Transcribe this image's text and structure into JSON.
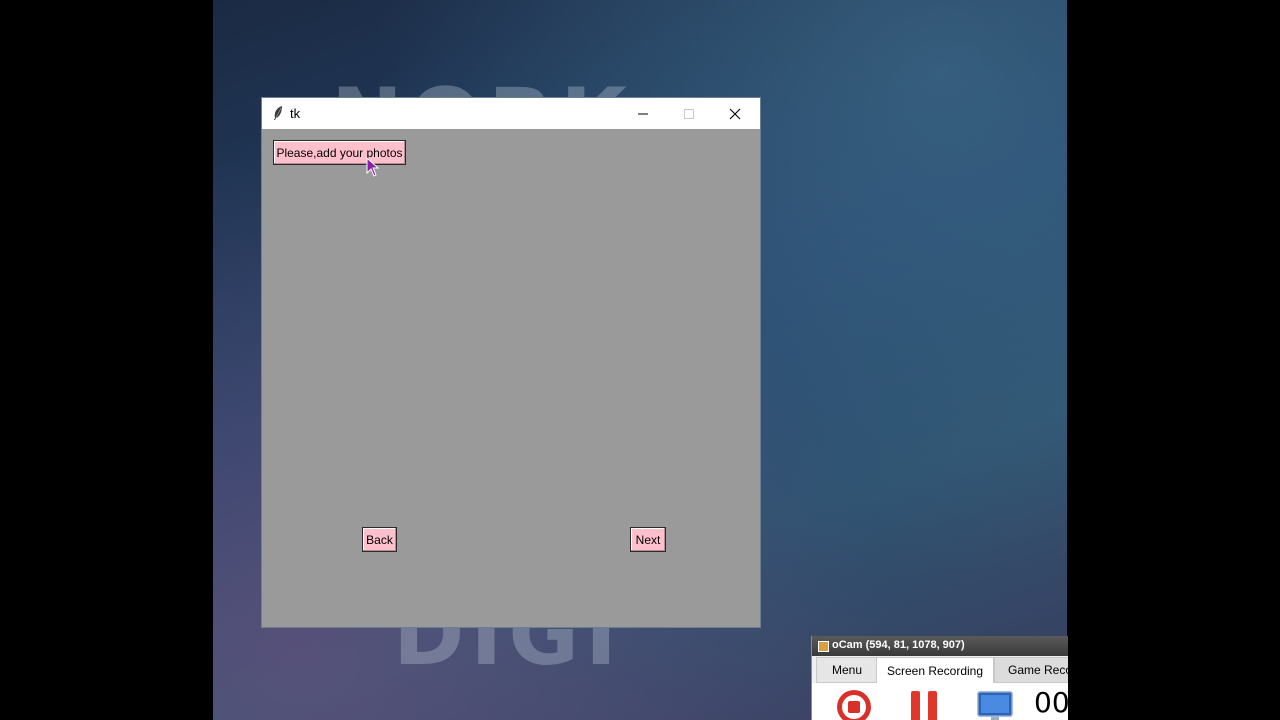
{
  "desktop": {
    "faint_text_top": "NORK",
    "faint_text_bottom": "DIGI"
  },
  "tk_window": {
    "title": "tk",
    "icon": "feather-icon",
    "background_color": "#9a9a9a",
    "button_color": "#ffc0cb",
    "add_photos_label": "Please,add your photos",
    "back_label": "Back",
    "next_label": "Next"
  },
  "ocam": {
    "title": "oCam (594, 81, 1078, 907)",
    "tabs": [
      "Menu",
      "Screen Recording",
      "Game Reco"
    ],
    "active_tab": "Screen Recording",
    "timer": "00",
    "icons": [
      "record-icon",
      "pause-icon",
      "screen-icon"
    ]
  }
}
